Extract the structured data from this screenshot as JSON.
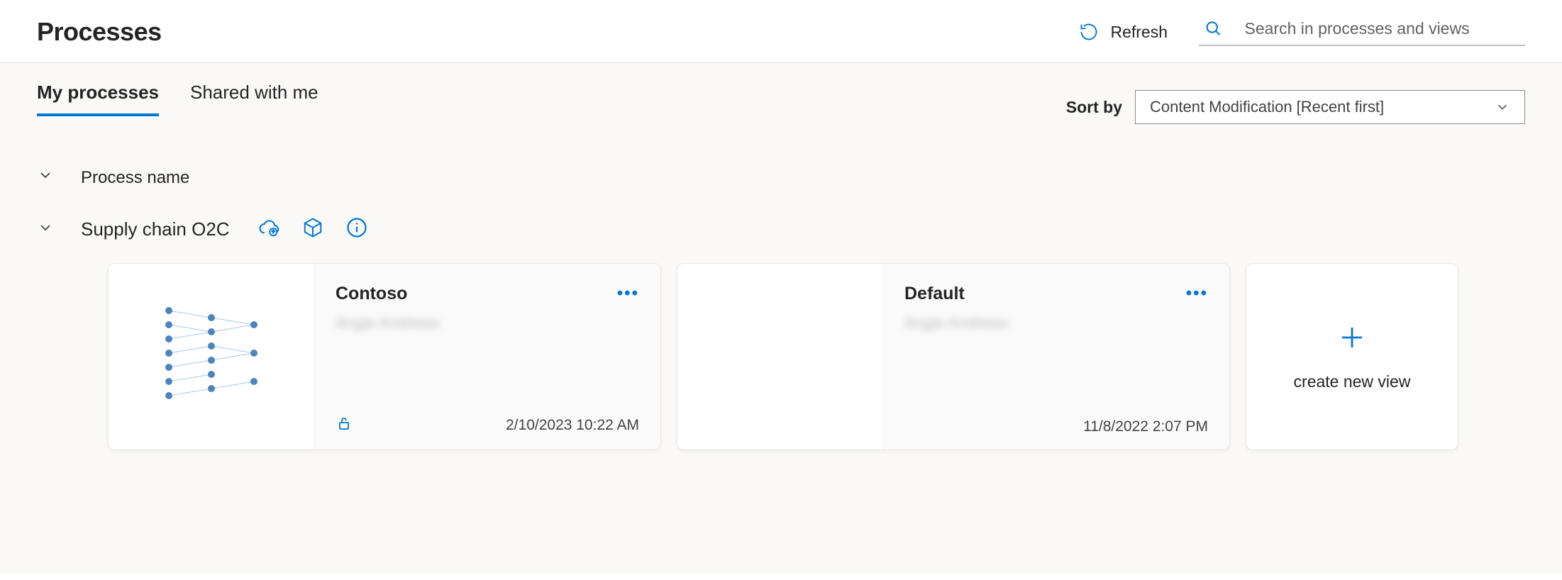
{
  "header": {
    "title": "Processes",
    "refresh_label": "Refresh",
    "search_placeholder": "Search in processes and views"
  },
  "tabs": {
    "my": "My processes",
    "shared": "Shared with me"
  },
  "sort": {
    "label": "Sort by",
    "selected": "Content Modification [Recent first]"
  },
  "group": {
    "header": "Process name"
  },
  "process": {
    "name": "Supply chain O2C"
  },
  "cards": [
    {
      "title": "Contoso",
      "subtitle": "Angie Andrews",
      "date": "2/10/2023 10:22 AM",
      "locked": true
    },
    {
      "title": "Default",
      "subtitle": "Angie Andrews",
      "date": "11/8/2022 2:07 PM",
      "locked": false
    }
  ],
  "new_view": {
    "label": "create new view"
  }
}
